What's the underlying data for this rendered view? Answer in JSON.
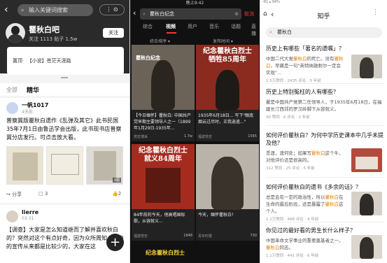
{
  "panel1": {
    "search_placeholder": "输入关键词搜索",
    "pill_label": "⋮ ⊙",
    "forum_title": "瞿秋白吧",
    "stats": "关注 1113   贴子 1.5w",
    "follow_label": "关注",
    "pinned_tag": "置顶",
    "pinned_text": "【小说】苍茫天涯路",
    "tabs": [
      "全部",
      "精华"
    ],
    "posts": [
      {
        "user": "一帆1017",
        "time": "4天前",
        "text": "普察冀版瞿秋白遗作《乱弹及其它》此书民国35年7月1日由鲁迅学会出版，此书现书店普察冀分店发行。可点击放大看。",
        "image_badge": "4图",
        "share": "分享",
        "comments": "3",
        "likes": "2"
      },
      {
        "user": "lierre",
        "time": "03-31",
        "text": "【调查】大家是怎么知道继而了解并喜欢秋白的？突然对这个有点好奇，因为众所周知，秋白的宣传从来都是比较少的，大家在这"
      }
    ],
    "fab_label": "+"
  },
  "panel2": {
    "status_time": "晚上9:42",
    "search_value": "瞿秋白纪念",
    "clear_icon": "⊗",
    "cancel_label": "取消",
    "tabs": [
      "综合",
      "视频",
      "用户",
      "音乐",
      "话题",
      "直播"
    ],
    "filters": [
      "综合排序 ▾",
      "发布时间 ▾"
    ],
    "videos": [
      {
        "overlay": "瞿秋白纪念",
        "caption": "【今日缅怀】瞿秋白: 中国共产党早期主要领导人之一（1899年1月29日-1935年...",
        "author": "党史博采",
        "likes": "1.7w"
      },
      {
        "overlay": "纪念瞿秋白烈士 牺牲85周年",
        "caption": "1935年6月18日... 写下\"眼底烟云过尽时，正我逍遥...\"",
        "author": "福建党史",
        "likes": "1565"
      },
      {
        "overlay": "纪念瞿秋白烈士 就义84周年",
        "caption": "84年前的今天，他高唱国际歌，从容就义...",
        "author": "福建党史",
        "likes": "1848"
      },
      {
        "overlay": "今天，我们缅怀瞿秋白！",
        "caption": "今天，缅怀瞿秋白！",
        "author": "青年时报",
        "likes": "730"
      }
    ],
    "bottom_banner": "纪念瞿秋白烈士"
  },
  "panel3": {
    "status": "4G ▴ 94%",
    "page_title": "知乎",
    "search_value": "瞿秋白",
    "questions": [
      {
        "title": "历史上有哪些「著名的遗嘱」？",
        "excerpt": "中国二代大党瞿秋白的死亡。没有瞿秋白，早晨是一句\"英特纳雄耐尔一定会实现\"...",
        "meta": "1.5万赞同 · 2435 评论 · 5 年前"
      },
      {
        "title": "历史上特别冤枉的人有哪些？",
        "excerpt": "瞿是中国共产党第二任领导人，于1935年6月18日，在福建长汀西郊的罗汉岭脚下从容就义。",
        "meta": "40 赞同 · 6 评论 · 2 年前"
      },
      {
        "title": "如何评价瞿秋白？为何中学历史课本中几乎未提及他？",
        "excerpt": "觅渡，渡何处；如果写瞿秋白这个牛，对他评价还是很高的。",
        "meta": "312 赞同 · 25 评论 · 5 年前"
      },
      {
        "title": "如何评价瞿秋白的遗书《多余的话》？",
        "excerpt": "总是会有一定的政治性，所以瞿秋白在生命的最后阶段，还是暴露了瞿秋白这个人。",
        "meta": "1.1万赞同 · 488 评论 · 4 年前"
      },
      {
        "title": "你见过的最好看的男生长什么样子？",
        "excerpt": "中国革命文学事业的重要奠基者之一，瞿秋白同志。",
        "meta": "1.1万赞同 · 441 评论 · 6 年前"
      }
    ]
  }
}
